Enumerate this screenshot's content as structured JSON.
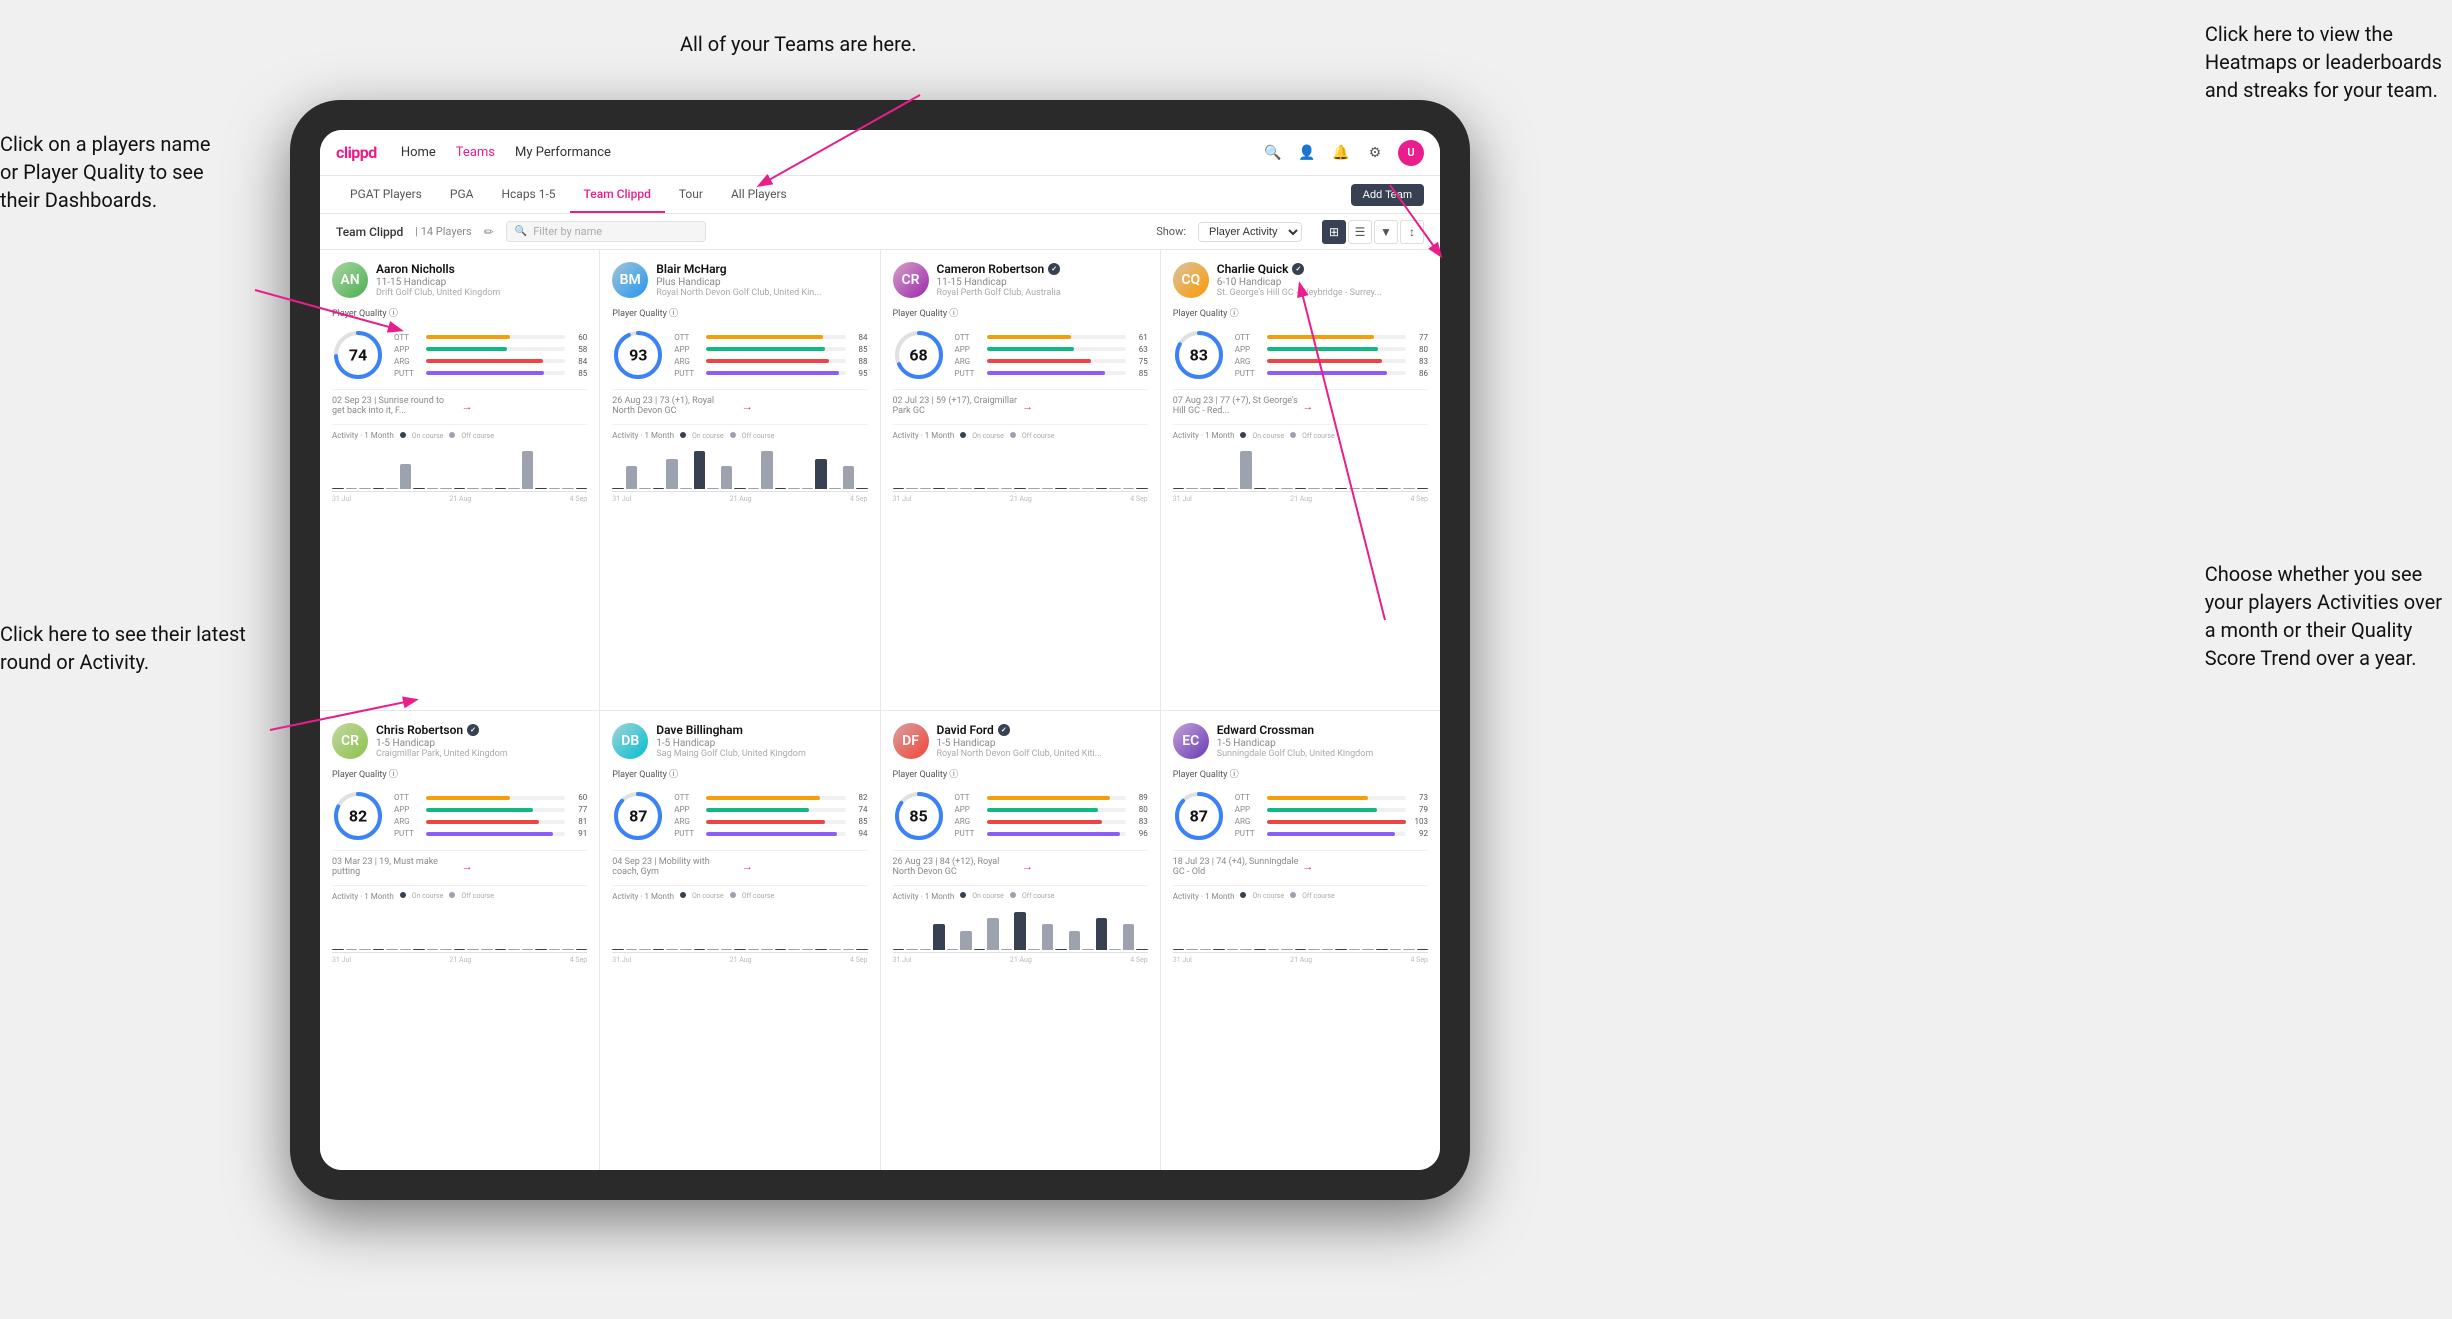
{
  "app": {
    "name": "clippd",
    "nav": {
      "items": [
        "Home",
        "Teams",
        "My Performance"
      ],
      "active": "Teams"
    },
    "sub_nav": {
      "items": [
        "PGAT Players",
        "PGA",
        "Hcaps 1-5",
        "Team Clippd",
        "Tour",
        "All Players"
      ],
      "active": "Team Clippd",
      "add_team_label": "Add Team"
    },
    "team_bar": {
      "name": "Team Clippd",
      "players": "14 Players",
      "search_placeholder": "Filter by name",
      "show_label": "Show:",
      "show_option": "Player Activity"
    }
  },
  "annotations": {
    "top_center": "All of your Teams are here.",
    "top_right_line1": "Click here to view the",
    "top_right_line2": "Heatmaps or leaderboards",
    "top_right_line3": "and streaks for your team.",
    "left_top_line1": "Click on a players name",
    "left_top_line2": "or Player Quality to see",
    "left_top_line3": "their Dashboards.",
    "left_bottom_line1": "Click here to see their latest",
    "left_bottom_line2": "round or Activity.",
    "right_bottom_line1": "Choose whether you see",
    "right_bottom_line2": "your players Activities over",
    "right_bottom_line3": "a month or their Quality",
    "right_bottom_line4": "Score Trend over a year."
  },
  "players": [
    {
      "name": "Aaron Nicholls",
      "handicap": "11-15 Handicap",
      "club": "Drift Golf Club, United Kingdom",
      "score": 74,
      "score_color": "#3b82f6",
      "score_pct": 74,
      "verified": false,
      "metrics": [
        {
          "label": "OTT",
          "value": 60,
          "color": "#f59e0b"
        },
        {
          "label": "APP",
          "value": 58,
          "color": "#10b981"
        },
        {
          "label": "ARG",
          "value": 84,
          "color": "#ef4444"
        },
        {
          "label": "PUTT",
          "value": 85,
          "color": "#8b5cf6"
        }
      ],
      "latest_round": "02 Sep 23 | Sunrise round to get back into it, F...",
      "activity_bars": [
        0,
        0,
        0,
        0,
        0,
        2,
        0,
        0,
        0,
        0,
        0,
        0,
        0,
        0,
        3,
        0,
        0,
        0,
        0
      ],
      "chart_labels": [
        "31 Jul",
        "21 Aug",
        "4 Sep"
      ]
    },
    {
      "name": "Blair McHarg",
      "handicap": "Plus Handicap",
      "club": "Royal North Devon Golf Club, United Kin...",
      "score": 93,
      "score_color": "#3b82f6",
      "score_pct": 93,
      "verified": false,
      "metrics": [
        {
          "label": "OTT",
          "value": 84,
          "color": "#f59e0b"
        },
        {
          "label": "APP",
          "value": 85,
          "color": "#10b981"
        },
        {
          "label": "ARG",
          "value": 88,
          "color": "#ef4444"
        },
        {
          "label": "PUTT",
          "value": 95,
          "color": "#8b5cf6"
        }
      ],
      "latest_round": "26 Aug 23 | 73 (+1), Royal North Devon GC",
      "activity_bars": [
        0,
        3,
        0,
        0,
        4,
        0,
        5,
        0,
        3,
        0,
        0,
        5,
        0,
        0,
        0,
        4,
        0,
        3,
        0
      ],
      "chart_labels": [
        "31 Jul",
        "21 Aug",
        "4 Sep"
      ]
    },
    {
      "name": "Cameron Robertson",
      "handicap": "11-15 Handicap",
      "club": "Royal Perth Golf Club, Australia",
      "score": 68,
      "score_color": "#3b82f6",
      "score_pct": 68,
      "verified": true,
      "metrics": [
        {
          "label": "OTT",
          "value": 61,
          "color": "#f59e0b"
        },
        {
          "label": "APP",
          "value": 63,
          "color": "#10b981"
        },
        {
          "label": "ARG",
          "value": 75,
          "color": "#ef4444"
        },
        {
          "label": "PUTT",
          "value": 85,
          "color": "#8b5cf6"
        }
      ],
      "latest_round": "02 Jul 23 | 59 (+17), Craigmillar Park GC",
      "activity_bars": [
        0,
        0,
        0,
        0,
        0,
        0,
        0,
        0,
        0,
        0,
        0,
        0,
        0,
        0,
        0,
        0,
        0,
        0,
        0
      ],
      "chart_labels": [
        "31 Jul",
        "21 Aug",
        "4 Sep"
      ]
    },
    {
      "name": "Charlie Quick",
      "handicap": "6-10 Handicap",
      "club": "St. George's Hill GC - Weybridge - Surrey...",
      "score": 83,
      "score_color": "#3b82f6",
      "score_pct": 83,
      "verified": true,
      "metrics": [
        {
          "label": "OTT",
          "value": 77,
          "color": "#f59e0b"
        },
        {
          "label": "APP",
          "value": 80,
          "color": "#10b981"
        },
        {
          "label": "ARG",
          "value": 83,
          "color": "#ef4444"
        },
        {
          "label": "PUTT",
          "value": 86,
          "color": "#8b5cf6"
        }
      ],
      "latest_round": "07 Aug 23 | 77 (+7), St George's Hill GC - Red...",
      "activity_bars": [
        0,
        0,
        0,
        0,
        0,
        3,
        0,
        0,
        0,
        0,
        0,
        0,
        0,
        0,
        0,
        0,
        0,
        0,
        0
      ],
      "chart_labels": [
        "31 Jul",
        "21 Aug",
        "4 Sep"
      ]
    },
    {
      "name": "Chris Robertson",
      "handicap": "1-5 Handicap",
      "club": "Craigmillar Park, United Kingdom",
      "score": 82,
      "score_color": "#3b82f6",
      "score_pct": 82,
      "verified": true,
      "metrics": [
        {
          "label": "OTT",
          "value": 60,
          "color": "#f59e0b"
        },
        {
          "label": "APP",
          "value": 77,
          "color": "#10b981"
        },
        {
          "label": "ARG",
          "value": 81,
          "color": "#ef4444"
        },
        {
          "label": "PUTT",
          "value": 91,
          "color": "#8b5cf6"
        }
      ],
      "latest_round": "03 Mar 23 | 19, Must make putting",
      "activity_bars": [
        0,
        0,
        0,
        0,
        0,
        0,
        0,
        0,
        0,
        0,
        0,
        0,
        0,
        0,
        0,
        0,
        0,
        0,
        0
      ],
      "chart_labels": [
        "31 Jul",
        "21 Aug",
        "4 Sep"
      ]
    },
    {
      "name": "Dave Billingham",
      "handicap": "1-5 Handicap",
      "club": "Sag Maing Golf Club, United Kingdom",
      "score": 87,
      "score_color": "#3b82f6",
      "score_pct": 87,
      "verified": false,
      "metrics": [
        {
          "label": "OTT",
          "value": 82,
          "color": "#f59e0b"
        },
        {
          "label": "APP",
          "value": 74,
          "color": "#10b981"
        },
        {
          "label": "ARG",
          "value": 85,
          "color": "#ef4444"
        },
        {
          "label": "PUTT",
          "value": 94,
          "color": "#8b5cf6"
        }
      ],
      "latest_round": "04 Sep 23 | Mobility with coach, Gym",
      "activity_bars": [
        0,
        0,
        0,
        0,
        0,
        0,
        0,
        0,
        0,
        0,
        0,
        0,
        0,
        0,
        0,
        0,
        0,
        0,
        0
      ],
      "chart_labels": [
        "31 Jul",
        "21 Aug",
        "4 Sep"
      ]
    },
    {
      "name": "David Ford",
      "handicap": "1-5 Handicap",
      "club": "Royal North Devon Golf Club, United Kiti...",
      "score": 85,
      "score_color": "#3b82f6",
      "score_pct": 85,
      "verified": true,
      "metrics": [
        {
          "label": "OTT",
          "value": 89,
          "color": "#f59e0b"
        },
        {
          "label": "APP",
          "value": 80,
          "color": "#10b981"
        },
        {
          "label": "ARG",
          "value": 83,
          "color": "#ef4444"
        },
        {
          "label": "PUTT",
          "value": 96,
          "color": "#8b5cf6"
        }
      ],
      "latest_round": "26 Aug 23 | 84 (+12), Royal North Devon GC",
      "activity_bars": [
        0,
        0,
        0,
        4,
        0,
        3,
        0,
        5,
        0,
        6,
        0,
        4,
        0,
        3,
        0,
        5,
        0,
        4,
        0
      ],
      "chart_labels": [
        "31 Jul",
        "21 Aug",
        "4 Sep"
      ]
    },
    {
      "name": "Edward Crossman",
      "handicap": "1-5 Handicap",
      "club": "Sunningdale Golf Club, United Kingdom",
      "score": 87,
      "score_color": "#3b82f6",
      "score_pct": 87,
      "verified": false,
      "metrics": [
        {
          "label": "OTT",
          "value": 73,
          "color": "#f59e0b"
        },
        {
          "label": "APP",
          "value": 79,
          "color": "#10b981"
        },
        {
          "label": "ARG",
          "value": 103,
          "color": "#ef4444"
        },
        {
          "label": "PUTT",
          "value": 92,
          "color": "#8b5cf6"
        }
      ],
      "latest_round": "18 Jul 23 | 74 (+4), Sunningdale GC - Old",
      "activity_bars": [
        0,
        0,
        0,
        0,
        0,
        0,
        0,
        0,
        0,
        0,
        0,
        0,
        0,
        0,
        0,
        0,
        0,
        0,
        0
      ],
      "chart_labels": [
        "31 Jul",
        "21 Aug",
        "4 Sep"
      ]
    }
  ]
}
